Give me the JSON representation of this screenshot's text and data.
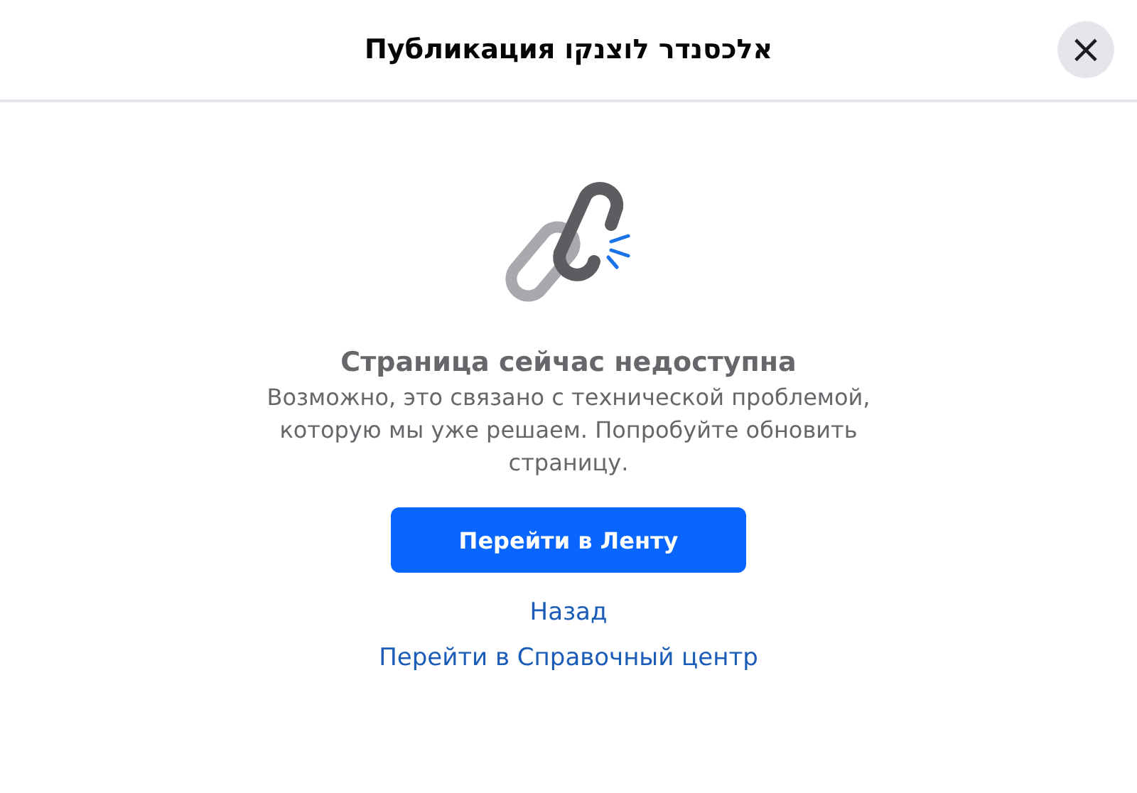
{
  "dialog": {
    "title": "Публикация אלכסנדר לוצנקו",
    "close_label": "×"
  },
  "error": {
    "heading": "Страница сейчас недоступна",
    "message": "Возможно, это связано с технической проблемой, которую мы уже решаем. Попробуйте обновить страницу."
  },
  "primary_button": "Перейти в Ленту",
  "links": [
    "Назад",
    "Перейти в Справочный центр"
  ]
}
